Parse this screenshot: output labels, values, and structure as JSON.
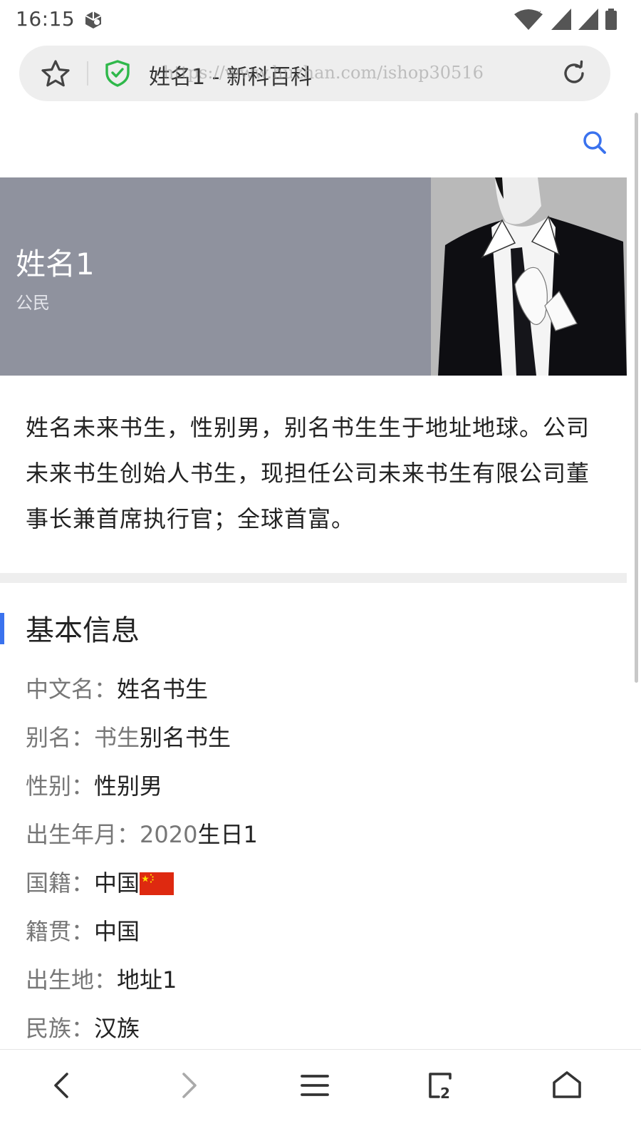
{
  "status_bar": {
    "time": "16:15",
    "icons": [
      "notification-app-icon",
      "wifi-icon",
      "signal-icon",
      "signal-icon",
      "battery-icon"
    ]
  },
  "address_bar": {
    "page_title": "姓名1 - 新科百科",
    "watermark": "https://www.huzhan.com/ishop30516",
    "icons": [
      "star-icon",
      "shield-check-icon",
      "reload-icon"
    ],
    "shield_color": "#2fb84a"
  },
  "header": {
    "icons": [
      "search-icon"
    ],
    "accent_color": "#3a72ee"
  },
  "hero": {
    "name": "姓名1",
    "subtitle": "公民",
    "background_color": "#8f929e"
  },
  "summary": {
    "text": "姓名未来书生，性别男，别名书生生于地址地球。公司未来书生创始人书生，现担任公司未来书生有限公司董事长兼首席执行官；全球首富。"
  },
  "basic_info": {
    "title": "基本信息",
    "rows": [
      {
        "label": "中文名：",
        "value": "姓名书生"
      },
      {
        "label": "别名：",
        "value_muted": "书生",
        "value": "别名书生"
      },
      {
        "label": "性别：",
        "value": "性别男"
      },
      {
        "label": "出生年月：",
        "value_muted": "2020",
        "value": "生日1"
      },
      {
        "label": "国籍：",
        "value": "中国",
        "flag_icon": "china-flag-icon"
      },
      {
        "label": "籍贯：",
        "value": "中国"
      },
      {
        "label": "出生地：",
        "value": "地址1"
      },
      {
        "label": "民族：",
        "value": "汉族"
      }
    ]
  },
  "bottom_nav": {
    "icons": [
      "back-icon",
      "forward-icon",
      "menu-icon",
      "tabs-icon",
      "home-icon"
    ],
    "tab_count": "2"
  }
}
